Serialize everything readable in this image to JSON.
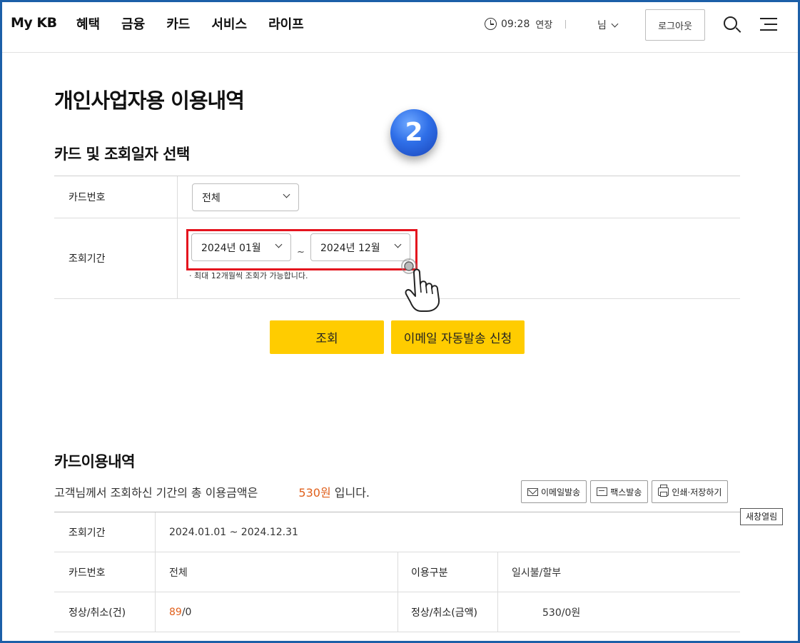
{
  "header": {
    "logo": "My KB",
    "nav": [
      "혜택",
      "금융",
      "카드",
      "서비스",
      "라이프"
    ],
    "time": "09:28",
    "extend_label": "연장",
    "user_label": "님",
    "logout_label": "로그아웃"
  },
  "page_title": "개인사업자용 이용내역",
  "step_badge": "2",
  "search_section": {
    "title": "카드 및 조회일자 선택",
    "card_number_label": "카드번호",
    "card_number_value": "전체",
    "period_label": "조회기간",
    "period_from": "2024년 01월",
    "period_to": "2024년 12월",
    "period_separator": "~",
    "note": "· 최대 12개월씩 조회가 가능합니다.",
    "search_button": "조회",
    "email_auto_button": "이메일 자동발송 신청"
  },
  "usage_section": {
    "title": "카드이용내역",
    "summary_prefix": "고객님께서 조회하신 기간의 총 이용금액은",
    "summary_amount": "530원",
    "summary_suffix": "입니다.",
    "email_button": "이메일발송",
    "fax_button": "팩스발송",
    "print_button": "인쇄·저장하기",
    "new_window": "새창열림",
    "rows": {
      "period_label": "조회기간",
      "period_value": "2024.01.01 ~ 2024.12.31",
      "card_label": "카드번호",
      "card_value": "전체",
      "usage_type_label": "이용구분",
      "usage_type_value": "일시불/할부",
      "count_label": "정상/취소(건)",
      "count_normal": "89",
      "count_cancel": "/0",
      "amount_label": "정상/취소(금액)",
      "amount_value": "530/0원"
    }
  },
  "colors": {
    "accent": "#ffcc00",
    "highlight": "#e4141e",
    "amount": "#e0601c",
    "frame": "#1c5fa8"
  }
}
